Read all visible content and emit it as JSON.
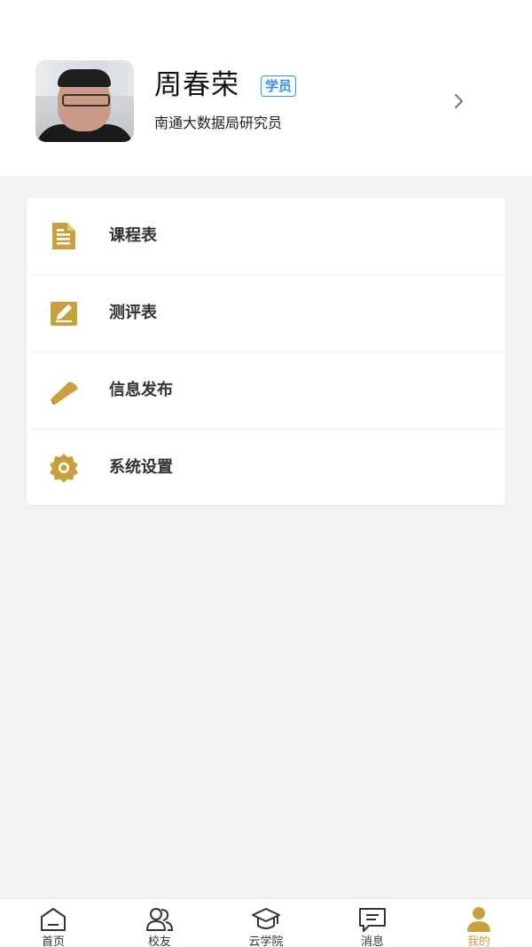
{
  "profile": {
    "name": "周春荣",
    "badge": "学员",
    "subtitle": "南通大数据局研究员"
  },
  "menu": [
    {
      "label": "课程表",
      "icon": "document-icon"
    },
    {
      "label": "测评表",
      "icon": "edit-icon"
    },
    {
      "label": "信息发布",
      "icon": "megaphone-icon"
    },
    {
      "label": "系统设置",
      "icon": "gear-icon"
    }
  ],
  "tabs": [
    {
      "label": "首页",
      "icon": "home-icon"
    },
    {
      "label": "校友",
      "icon": "people-icon"
    },
    {
      "label": "云学院",
      "icon": "graduation-cap-icon"
    },
    {
      "label": "消息",
      "icon": "message-icon"
    },
    {
      "label": "我的",
      "icon": "user-icon",
      "active": true
    }
  ],
  "colors": {
    "accent": "#c9a13c",
    "badge": "#2f8fe8",
    "background": "#f3f3f3"
  }
}
